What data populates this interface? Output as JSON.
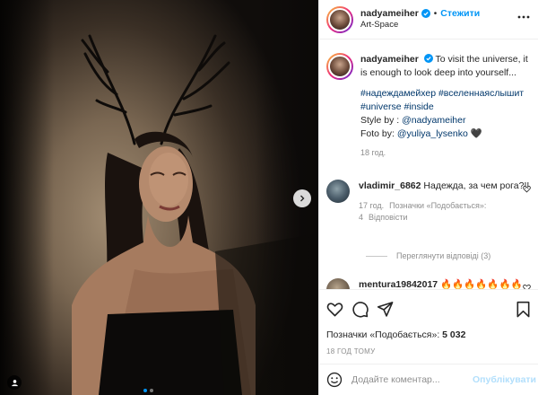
{
  "header": {
    "username": "nadyameiher",
    "separator": "•",
    "follow_label": "Стежити",
    "location": "Art-Space"
  },
  "caption": {
    "username": "nadyameiher",
    "text": "To visit the universe, it is enough to look deep into yourself...",
    "hashtags": "#надеждамейхер #вселеннаяслышит #universe #inside",
    "style_prefix": "Style by : ",
    "style_handle": "@nadyameiher",
    "photo_prefix": "Foto by: ",
    "photo_handle": "@yuliya_lysenko",
    "photo_suffix": "🖤",
    "time": "18 год."
  },
  "comments": [
    {
      "username": "vladimir_6862",
      "text": "Надежда, за чем рога?!!",
      "time": "17 год.",
      "likes": "Позначки «Подобається»: 4",
      "reply": "Відповісти",
      "view_replies": "Переглянути відповіді (3)"
    },
    {
      "username": "mentura19842017",
      "text": "🔥🔥🔥🔥🔥🔥🔥"
    }
  ],
  "actions": {
    "likes_label": "Позначки «Подобається»:",
    "likes_count": "5 032",
    "post_time": "18 ГОД ТОМУ"
  },
  "add_comment": {
    "placeholder": "Додайте коментар...",
    "publish_label": "Опублікувати"
  },
  "colors": {
    "accent_blue": "#0095f6",
    "link_blue": "#00376b",
    "muted_gray": "#8e8e8e",
    "publish_disabled": "#b2dffc"
  },
  "icons": [
    "more-options-icon",
    "verified-badge-icon",
    "heart-icon",
    "comment-icon",
    "share-icon",
    "bookmark-icon",
    "emoji-icon",
    "chevron-right-icon",
    "user-tag-icon"
  ]
}
